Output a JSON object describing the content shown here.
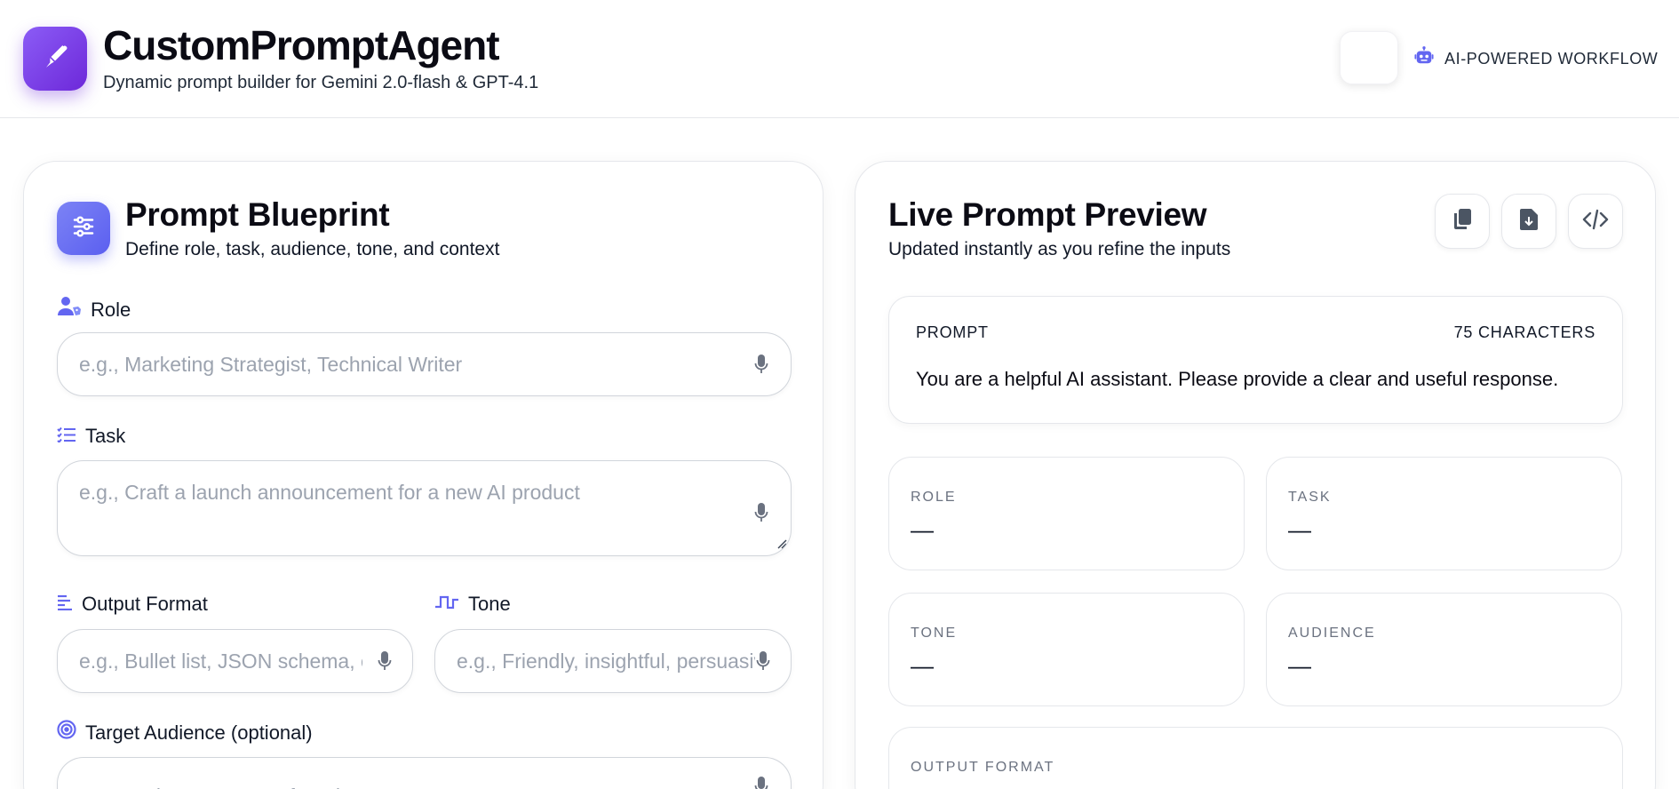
{
  "header": {
    "title": "CustomPromptAgent",
    "subtitle": "Dynamic prompt builder for Gemini 2.0-flash & GPT-4.1",
    "badge": "AI-POWERED WORKFLOW"
  },
  "blueprint": {
    "title": "Prompt Blueprint",
    "subtitle": "Define role, task, audience, tone, and context",
    "fields": {
      "role": {
        "label": "Role",
        "placeholder": "e.g., Marketing Strategist, Technical Writer",
        "value": ""
      },
      "task": {
        "label": "Task",
        "placeholder": "e.g., Craft a launch announcement for a new AI product",
        "value": ""
      },
      "format": {
        "label": "Output Format",
        "placeholder": "e.g., Bullet list, JSON schema, outline",
        "value": ""
      },
      "tone": {
        "label": "Tone",
        "placeholder": "e.g., Friendly, insightful, persuasive",
        "value": ""
      },
      "audience": {
        "label": "Target Audience (optional)",
        "placeholder": "e.g., Early-stage SaaS founders",
        "value": ""
      }
    }
  },
  "preview": {
    "title": "Live Prompt Preview",
    "subtitle": "Updated instantly as you refine the inputs",
    "prompt_label": "PROMPT",
    "char_count": "75 CHARACTERS",
    "prompt_text": "You are a helpful AI assistant. Please provide a clear and useful response.",
    "cards": [
      {
        "label": "ROLE",
        "value": "—"
      },
      {
        "label": "TASK",
        "value": "—"
      },
      {
        "label": "TONE",
        "value": "—"
      },
      {
        "label": "AUDIENCE",
        "value": "—"
      },
      {
        "label": "OUTPUT FORMAT",
        "value": ""
      }
    ]
  },
  "colors": {
    "brand": "#7c3aed",
    "accent": "#5b5ff0",
    "border": "#e5e7eb",
    "placeholder": "#9ca3af"
  },
  "icons": [
    "pen-icon",
    "robot-icon",
    "sliders-icon",
    "user-tag-icon",
    "checklist-icon",
    "align-left-icon",
    "wave-icon",
    "target-icon",
    "mic-icon",
    "copy-icon",
    "download-file-icon",
    "code-icon"
  ]
}
